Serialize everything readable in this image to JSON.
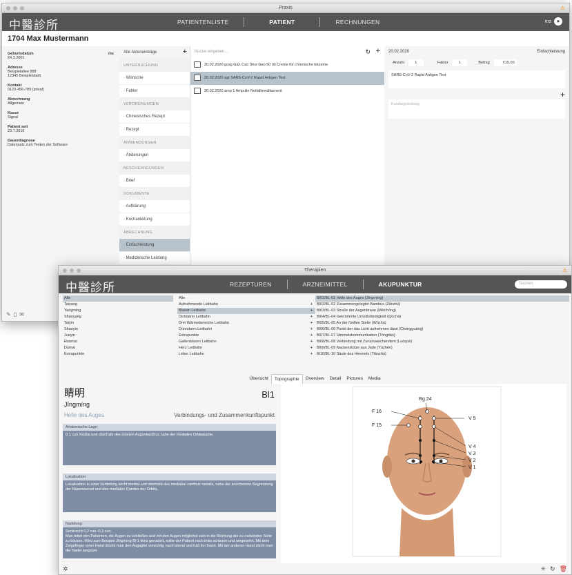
{
  "win1": {
    "title": "Praxis",
    "logo": "中醫診所",
    "nav": [
      "PATIENTENLISTE",
      "PATIENT",
      "RECHNUNGEN"
    ],
    "user": "ms",
    "patient": "1704  Max Mustermann",
    "info": {
      "geb_label": "Geburtsdatum",
      "geb_ms": "ms",
      "geb": "24.3.2001",
      "adr_label": "Adresse",
      "adr1": "Beispielallee 888",
      "adr2": "12345 Beispielstadt",
      "kontakt_label": "Kontakt",
      "kontakt": "0123-456-789 (privat)",
      "abr_label": "Abrechnung",
      "abr": "Allgemein",
      "kasse_label": "Kasse",
      "kasse": "Signal",
      "seit_label": "Patient seit",
      "seit": "23.7.2016",
      "dd_label": "Dauerdiagnose",
      "dd": "Datensatz zum Testen der Software"
    },
    "lister": {
      "all": "Alle Akteneinträge",
      "plus": "+",
      "rows": [
        {
          "t": "UNTERSUCHUNG",
          "h": true
        },
        {
          "t": "· Wünsche"
        },
        {
          "t": "· Fehler"
        },
        {
          "t": "VERORDNUNGEN",
          "h": true
        },
        {
          "t": "· Chinesisches Rezept"
        },
        {
          "t": "· Rezept"
        },
        {
          "t": "ANWENDUNGEN",
          "h": true
        },
        {
          "t": "· Änderungen"
        },
        {
          "t": "BESCHEINIGUNGEN",
          "h": true
        },
        {
          "t": "· Brief"
        },
        {
          "t": "DOKUMENTE",
          "h": true
        },
        {
          "t": "· Aufklärung"
        },
        {
          "t": "· Kochanleitung"
        },
        {
          "t": "ABRECHNUNG",
          "h": true
        },
        {
          "t": "· Einfachleistung",
          "sel": true
        },
        {
          "t": "· Medizinische Leistung"
        }
      ]
    },
    "entries": {
      "placeholder": "Kürzel eingeben...",
      "items": [
        "20.02.2020  gcsg Gan Cao Shui Gao 50 ml Creme für chronische Ekzeme",
        "20.02.2020  agt SARS-CoV-2 Rapid Antigen Test",
        "20.02.2020  amp 1 Ampulle Notfallmedikament"
      ]
    },
    "detail": {
      "date": "20.02.2020",
      "type": "Einfachleistung",
      "anzahl_l": "Anzahl",
      "anzahl": "1",
      "faktor_l": "Faktor",
      "faktor": "1",
      "betrag_l": "Betrag",
      "betrag": "€15.00",
      "text": "SARS-CoV-2 Rapid Antigen Test",
      "plus": "+",
      "kurz_placeholder": "Kurzbegründung"
    }
  },
  "win2": {
    "title": "Therapien",
    "logo": "中醫診所",
    "nav": [
      "REZEPTUREN",
      "ARZNEIMITTEL",
      "AKUPUNKTUR"
    ],
    "search": "Suchen",
    "col1": [
      "Alle",
      "Taiyang",
      "Yangming",
      "Shaoyang",
      "Taiyin",
      "Shaoyin",
      "Jueyin",
      "Renmai",
      "Dumai",
      "Extrapunkte"
    ],
    "col2": [
      "Alle",
      "Aufnehmende Leitbahn",
      "Blasen Leitbahn",
      "Dickdarm Leitbahn",
      "Drei Wärmebereiche Leitbahn",
      "Dünndarm Leitbahn",
      "Extrapunkte",
      "Gallenblasen Leitbahn",
      "Herz Leitbahn",
      "Leber Leitbahn"
    ],
    "col3": [
      "Bl01/BL-01 Helle des Auges (Jīngmíng)",
      "Bl02/BL-02 Zusammengelegter Bambus (Zǎnzhú)",
      "Bl03/BL-03 Straße der Augenbraue (Méichōng)",
      "Bl04/BL-04 Gekrümmte Unvollständigkeit (Qūchā)",
      "Bl05/BL-05 An der fünften Stelle (Wǔchù)",
      "Bl06/BL-06 Punkt der das Licht aufnehmen lässt (Chéngguāng)",
      "Bl07/BL-07 Himmelskommunikation (Tōngtiān)",
      "Bl08/BL-08 Verbindung mit Zurückweichendem (Luòquè)",
      "Bl09/BL-09 Nackenstütze aus Jade (Yùzhěn)",
      "Bl10/BL-10 Säule des Himmels (Tiānzhù)"
    ],
    "tabs": [
      "Übersicht",
      "Topographie",
      "Overview",
      "Detail",
      "Pictures",
      "Media"
    ],
    "point": {
      "hanzi": "睛明",
      "code": "Bl1",
      "pinyin": "Jīngmíng",
      "name_de": "Helle des Auges",
      "category": "Verbindungs- und Zusammenkunftspunkt",
      "anat_l": "Anatomische Lage:",
      "anat": "0,1 cun medial und oberhalb des inneren Augenkanthus nahe der medialen Orbitakante.",
      "lok_l": "Lokalisation:",
      "lok": "Lokalisation in einer Vertiefung leicht medial und oberhalb des medialen canthus nasalis, nahe der knöchernen Begrenzung der Nasenwurzel und des medialen Randes der Orbita.",
      "nad_l": "Nadelung:",
      "nad": "Senkrecht 0,2 cun–0,3 cun.\nMan bittet den Patienten, die Augen zu schließen und mit den Augen möglichst weit in die Richtung der zu nadelnden Seite zu blicken. Wird zum Beispiel Jīngmíng Bl-1 links genadelt, sollte der Patient nach links schauen und umgekehrt. Mit dem Zeigefinger einer Hand drückt man den Augapfel vorsichtig nach lateral und hält ihn fixiert. Mit der anderen Hand sticht man die Nadel langsam"
    },
    "figure_labels": [
      "Rg 24",
      "F 16",
      "F 15",
      "V 5",
      "V 4",
      "V 3",
      "V 2",
      "V 1"
    ]
  }
}
